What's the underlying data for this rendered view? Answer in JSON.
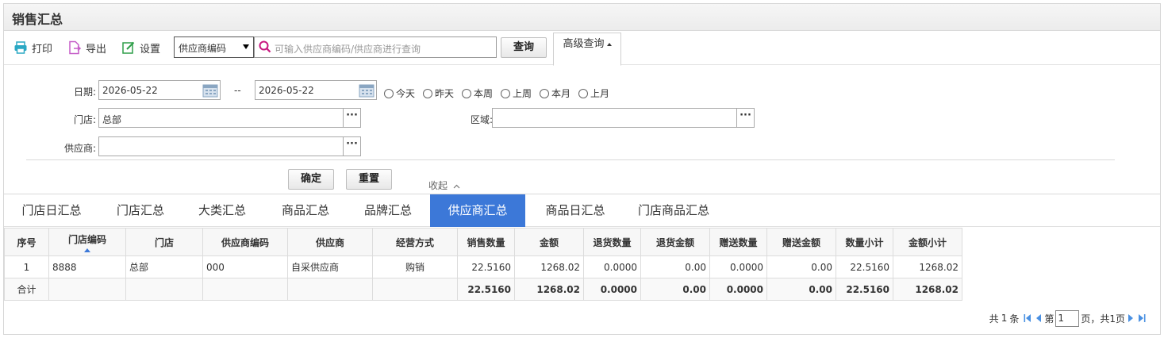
{
  "page": {
    "title": "销售汇总"
  },
  "toolbar": {
    "print_label": "打印",
    "export_label": "导出",
    "settings_label": "设置",
    "field_select": "供应商编码",
    "search_placeholder": "可输入供应商编码/供应商进行查询",
    "query_label": "查询",
    "advanced_label": "高级查询"
  },
  "form": {
    "date_label": "日期:",
    "date_from": "2026-05-22",
    "date_sep": "--",
    "date_to": "2026-05-22",
    "quick_dates": [
      "今天",
      "昨天",
      "本周",
      "上周",
      "本月",
      "上月"
    ],
    "store_label": "门店:",
    "store_value": "总部",
    "region_label": "区域:",
    "region_value": "",
    "supplier_label": "供应商:",
    "supplier_value": "",
    "confirm_label": "确定",
    "reset_label": "重置",
    "collapse_label": "收起"
  },
  "tabs": [
    "门店日汇总",
    "门店汇总",
    "大类汇总",
    "商品汇总",
    "品牌汇总",
    "供应商汇总",
    "商品日汇总",
    "门店商品汇总"
  ],
  "active_tab": "供应商汇总",
  "table": {
    "columns": [
      "序号",
      "门店编码",
      "门店",
      "供应商编码",
      "供应商",
      "经营方式",
      "销售数量",
      "金额",
      "退货数量",
      "退货金额",
      "赠送数量",
      "赠送金额",
      "数量小计",
      "金额小计"
    ],
    "rows": [
      [
        "1",
        "8888",
        "总部",
        "000",
        "自采供应商",
        "购销",
        "22.5160",
        "1268.02",
        "0.0000",
        "0.00",
        "0.0000",
        "0.00",
        "22.5160",
        "1268.02"
      ]
    ],
    "total": [
      "合计",
      "",
      "",
      "",
      "",
      "",
      "22.5160",
      "1268.02",
      "0.0000",
      "0.00",
      "0.0000",
      "0.00",
      "22.5160",
      "1268.02"
    ]
  },
  "pager": {
    "total_prefix": "共",
    "total_count": "1",
    "total_suffix": "条",
    "page_prefix": "第",
    "current_page": "1",
    "page_suffix": "页，共1页"
  },
  "colors": {
    "accent": "#3c78d8"
  }
}
